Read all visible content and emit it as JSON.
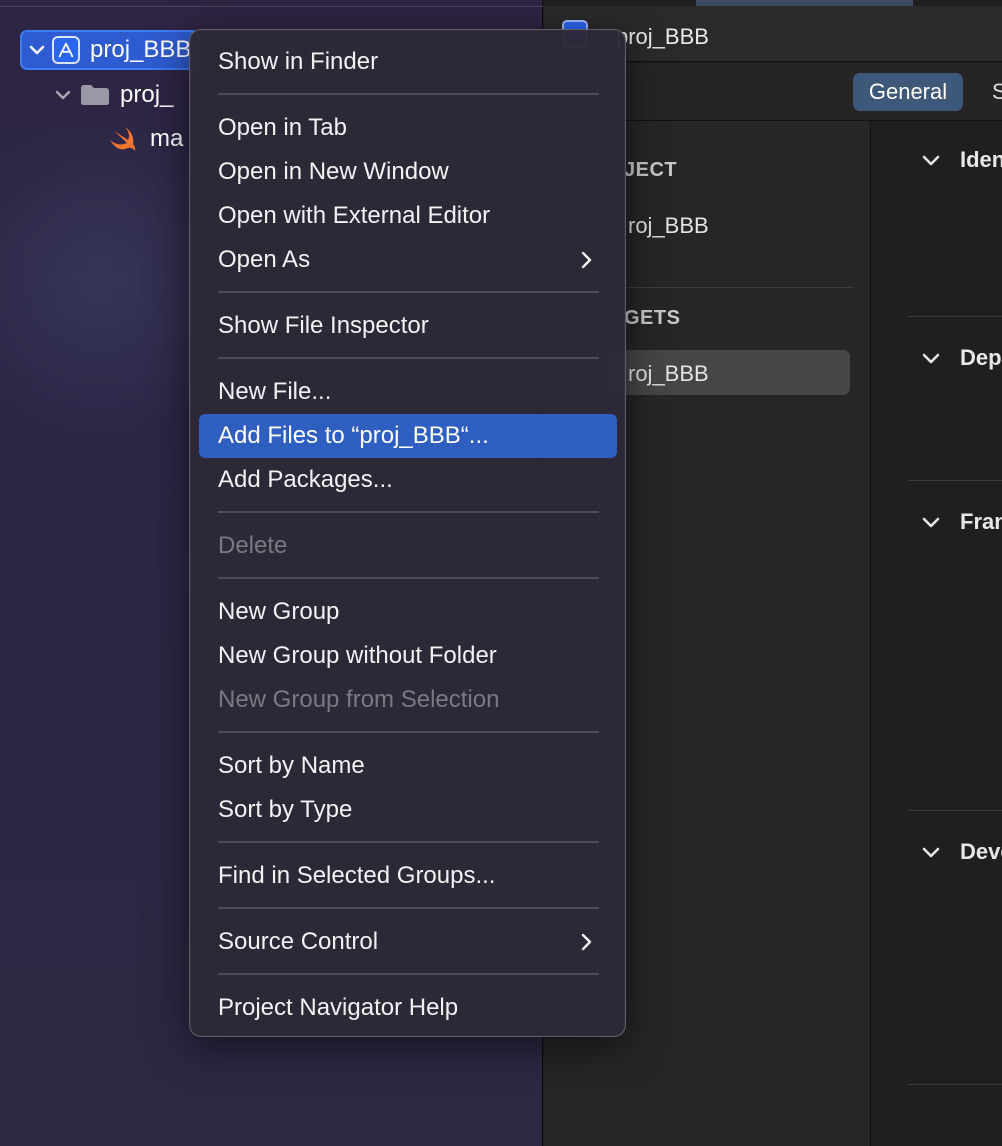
{
  "navigator": {
    "project_label": "proj_BBB",
    "folder_label": "proj_",
    "file_label": "ma"
  },
  "editor": {
    "breadcrumb_label": "proj_BBB",
    "tabs": {
      "general": "General",
      "next": "S"
    },
    "outline": {
      "project_section": "JECT",
      "project_item": "roj_BBB",
      "targets_section": "GETS",
      "target_item": "roj_BBB"
    },
    "sections": [
      {
        "title": "Iden"
      },
      {
        "title": "Dep"
      },
      {
        "title": "Fran"
      },
      {
        "title": "Deve"
      }
    ]
  },
  "context_menu": {
    "items": [
      {
        "label": "Show in Finder"
      },
      {
        "label": "Open in Tab"
      },
      {
        "label": "Open in New Window"
      },
      {
        "label": "Open with External Editor"
      },
      {
        "label": "Open As",
        "submenu": true
      },
      {
        "label": "Show File Inspector"
      },
      {
        "label": "New File..."
      },
      {
        "label": "Add Files to “proj_BBB“...",
        "highlighted": true
      },
      {
        "label": "Add Packages..."
      },
      {
        "label": "Delete",
        "disabled": true
      },
      {
        "label": "New Group"
      },
      {
        "label": "New Group without Folder"
      },
      {
        "label": "New Group from Selection",
        "disabled": true
      },
      {
        "label": "Sort by Name"
      },
      {
        "label": "Sort by Type"
      },
      {
        "label": "Find in Selected Groups..."
      },
      {
        "label": "Source Control",
        "submenu": true
      },
      {
        "label": "Project Navigator Help"
      }
    ]
  },
  "colors": {
    "highlight": "#2e5ec0",
    "selection_border": "#3d7cf5",
    "swift_orange": "#f0742f"
  },
  "icons": [
    "chevron-down-icon",
    "app-project-icon",
    "folder-icon",
    "swift-file-icon",
    "chevron-right-icon"
  ]
}
